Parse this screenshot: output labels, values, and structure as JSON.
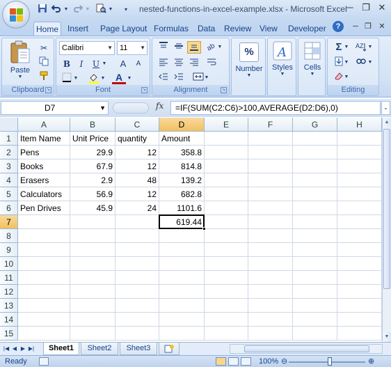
{
  "window": {
    "title": "nested-functions-in-excel-example.xlsx - Microsoft Excel",
    "minimize": "─",
    "restore": "❐",
    "close": "✕"
  },
  "qat": {
    "save_icon": "save-icon",
    "undo_icon": "undo-icon",
    "redo_icon": "redo-icon",
    "print_preview_icon": "print-preview-icon",
    "customize_icon": "qat-dropdown-icon"
  },
  "tabs": [
    "Home",
    "Insert",
    "Page Layout",
    "Formulas",
    "Data",
    "Review",
    "View",
    "Developer"
  ],
  "ribbon": {
    "clipboard": {
      "label": "Clipboard",
      "paste": "Paste"
    },
    "font": {
      "label": "Font",
      "name": "Calibri",
      "size": "11",
      "bold": "B",
      "italic": "I",
      "underline": "U",
      "grow": "A",
      "shrink": "A",
      "font_color_letter": "A",
      "font_color": "#c00000",
      "fill_color": "#ffff00"
    },
    "alignment": {
      "label": "Alignment"
    },
    "number": {
      "label": "Number",
      "symbol": "%"
    },
    "styles": {
      "label": "Styles"
    },
    "cells": {
      "label": "Cells"
    },
    "editing": {
      "label": "Editing",
      "sum_symbol": "Σ"
    }
  },
  "formula_bar": {
    "name_box": "D7",
    "fx": "fx",
    "formula": "=IF(SUM(C2:C6)>100,AVERAGE(D2:D6),0)"
  },
  "grid": {
    "columns": [
      "A",
      "B",
      "C",
      "D",
      "E",
      "F",
      "G",
      "H"
    ],
    "selected_column": "D",
    "row_numbers": [
      "1",
      "2",
      "3",
      "4",
      "5",
      "6",
      "7",
      "8",
      "9",
      "10",
      "11",
      "12",
      "13",
      "14",
      "15"
    ],
    "selected_row": "7",
    "rows": [
      [
        "Item Name",
        "Unit Price",
        "quantity",
        "Amount"
      ],
      [
        "Pens",
        "29.9",
        "12",
        "358.8"
      ],
      [
        "Books",
        "67.9",
        "12",
        "814.8"
      ],
      [
        "Erasers",
        "2.9",
        "48",
        "139.2"
      ],
      [
        "Calculators",
        "56.9",
        "12",
        "682.8"
      ],
      [
        "Pen Drives",
        "45.9",
        "24",
        "1101.6"
      ],
      [
        "",
        "",
        "",
        "619.44"
      ]
    ],
    "active_cell": "D7"
  },
  "sheets": [
    "Sheet1",
    "Sheet2",
    "Sheet3"
  ],
  "active_sheet": "Sheet1",
  "status": {
    "mode": "Ready",
    "zoom": "100%",
    "zoom_fraction": 1.0
  }
}
